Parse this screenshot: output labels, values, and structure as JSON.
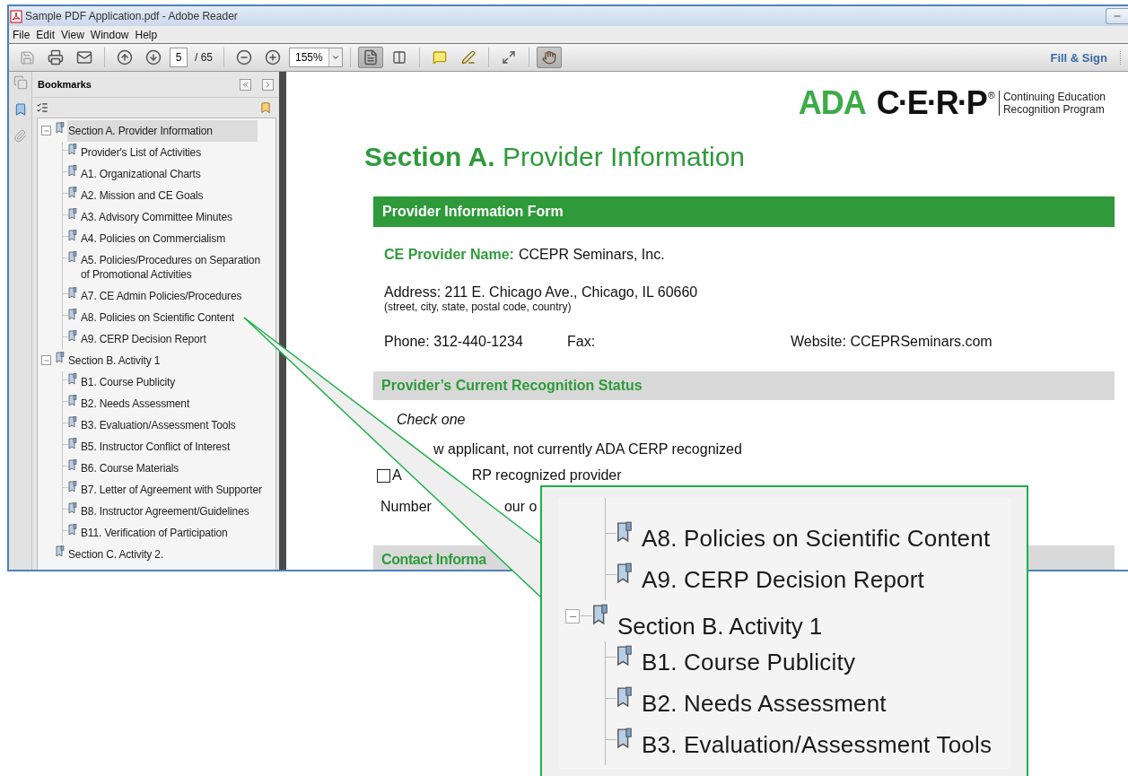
{
  "window": {
    "title": "Sample PDF Application.pdf - Adobe Reader"
  },
  "menu": [
    "File",
    "Edit",
    "View",
    "Window",
    "Help"
  ],
  "toolbar": {
    "page": "5",
    "page_count": "/ 65",
    "zoom": "155%",
    "fill_sign": "Fill & Sign",
    "hand_selected": true
  },
  "bookmarks_panel": {
    "title": "Bookmarks",
    "tree": [
      {
        "label": "Section A. Provider Information",
        "selected": true,
        "expanded": true,
        "children": [
          {
            "label": "Provider's List of Activities",
            "selected": false
          },
          {
            "label": "A1. Organizational Charts",
            "selected": false
          },
          {
            "label": "A2. Mission and CE Goals",
            "selected": false
          },
          {
            "label": "A3. Advisory Committee Minutes",
            "selected": false
          },
          {
            "label": "A4. Policies on Commercialism",
            "selected": false
          },
          {
            "label": "A5. Policies/Procedures on Separation of Promotional Activities",
            "selected": false
          },
          {
            "label": "A7. CE Admin Policies/Procedures",
            "selected": false
          },
          {
            "label": "A8. Policies on Scientific Content",
            "selected": false
          },
          {
            "label": "A9. CERP Decision Report",
            "selected": false
          }
        ]
      },
      {
        "label": "Section B. Activity 1",
        "selected": false,
        "expanded": true,
        "children": [
          {
            "label": "B1. Course Publicity",
            "selected": false
          },
          {
            "label": "B2. Needs Assessment",
            "selected": false
          },
          {
            "label": "B3. Evaluation/Assessment Tools",
            "selected": false
          },
          {
            "label": "B5. Instructor Conflict of Interest",
            "selected": false
          },
          {
            "label": "B6. Course Materials",
            "selected": false
          },
          {
            "label": "B7. Letter of Agreement with Supporter",
            "selected": false
          },
          {
            "label": "B8. Instructor Agreement/Guidelines",
            "selected": false
          },
          {
            "label": "B11. Verification of Participation",
            "selected": false
          }
        ]
      },
      {
        "label": "Section C. Activity 2.",
        "selected": false
      }
    ]
  },
  "document": {
    "logo": {
      "mark": "ADA",
      "name": "C·E·R·P",
      "reg": "®",
      "tagline": [
        "Continuing Education",
        "Recognition Program"
      ]
    },
    "heading": "**Section A.** Provider Information",
    "form_bar": "Provider Information Form",
    "provider_name": {
      "label": "CE Provider Name:",
      "value": "CCEPR Seminars, Inc."
    },
    "address": "Address: 211 E. Chicago Ave., Chicago, IL 60660",
    "address_hint": "(street, city, state, postal code, country)",
    "phone": "Phone: 312-440-1234",
    "fax": "Fax:",
    "website": "Website: CCEPRSeminars.com",
    "status_bar": "Provider’s Current Recognition Status",
    "check_one": "Check one",
    "status_lines": [
      {
        "kind": "text",
        "parts": [
          "w applicant, not currently ADA CERP recognized"
        ]
      },
      {
        "kind": "checkbox",
        "checked": false,
        "parts": [
          "A",
          "RP recognized provider"
        ]
      },
      {
        "kind": "text",
        "parts": [
          "Number",
          "our o"
        ]
      }
    ],
    "contact_bar": "Contact Informa"
  },
  "callout": {
    "tail_items": [
      "A8. Policies on Scientific Content",
      "A9. CERP Decision Report"
    ],
    "sections": [
      {
        "label": "Section B. Activity 1",
        "expanded": true,
        "children": [
          "B1. Course Publicity",
          "B2. Needs Assessment",
          "B3. Evaluation/Assessment Tools"
        ]
      }
    ]
  }
}
